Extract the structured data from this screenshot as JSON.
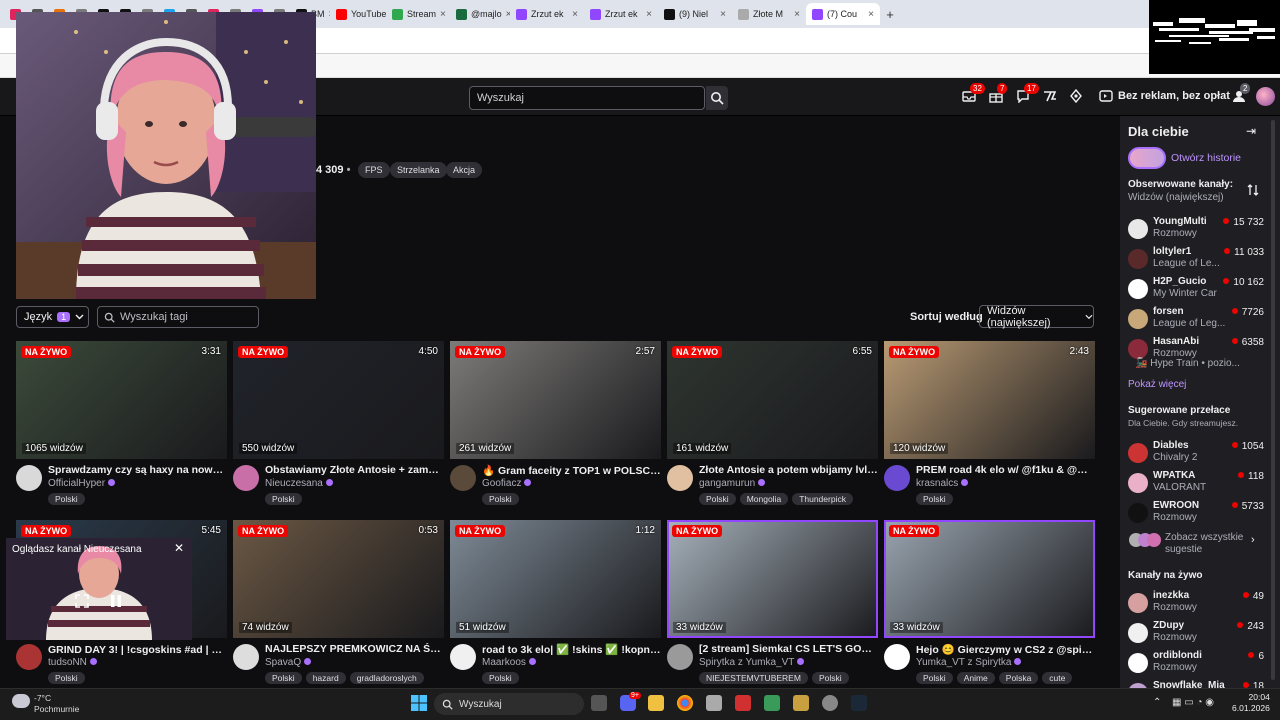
{
  "browser": {
    "tabs": [
      {
        "label": "",
        "color": "#e0245e"
      },
      {
        "label": "",
        "color": "#555"
      },
      {
        "label": "",
        "color": "#e8710a"
      },
      {
        "label": "",
        "color": "#7a7a7a"
      },
      {
        "label": "",
        "color": "#111"
      },
      {
        "label": "",
        "color": "#111"
      },
      {
        "label": "",
        "color": "#7a7a7a"
      },
      {
        "label": "",
        "color": "#1da1f2"
      },
      {
        "label": "",
        "color": "#555"
      },
      {
        "label": "",
        "color": "#e0245e"
      },
      {
        "label": "",
        "color": "#7a7a7a"
      },
      {
        "label": "",
        "color": "#9147ff"
      },
      {
        "label": "",
        "color": "#7a7a7a"
      },
      {
        "label": "BM",
        "color": "#111"
      },
      {
        "label": "YouTube",
        "color": "#ff0000"
      },
      {
        "label": "Stream",
        "color": "#2fa84f"
      },
      {
        "label": "@majlo",
        "color": "#1a6b3d"
      },
      {
        "label": "Zrzut ek",
        "color": "#9147ff"
      },
      {
        "label": "Zrzut ek",
        "color": "#9147ff"
      },
      {
        "label": "(9) Niel",
        "color": "#111"
      },
      {
        "label": "Złote M",
        "color": "#aaa"
      },
      {
        "label": "(7) Cou",
        "color": "#9147ff",
        "active": true
      }
    ]
  },
  "topnav": {
    "search_placeholder": "Wyszukaj",
    "inbox_count": "32",
    "drops_count": "7",
    "notifications_count": "17",
    "ad_free_label": "Bez reklam, bez opłat",
    "bits_count": "2"
  },
  "category": {
    "viewers": "4 309",
    "tags": [
      "FPS",
      "Strzelanka",
      "Akcja"
    ]
  },
  "filters": {
    "language_label": "Język",
    "language_count": "1",
    "tag_search_placeholder": "Wyszukaj tagi",
    "sort_label": "Sortuj według",
    "sort_value": "Widzów (największej)"
  },
  "live_label": "NA ŻYWO",
  "streams": [
    {
      "duration": "3:31",
      "viewers": "1065 widzów",
      "title": "Sprawdzamy czy są haxy na nowym V...",
      "channel": "OfficialHyper",
      "tags": [
        "Polski"
      ],
      "thumb": "#3b4a3a",
      "avatar": "#d9d9d9"
    },
    {
      "duration": "4:50",
      "viewers": "550 widzów",
      "title": "Obstawiamy Złote Antosie + zamówił...",
      "channel": "Nieuczesana",
      "tags": [
        "Polski"
      ],
      "thumb": "#20232a",
      "avatar": "#c86fa8"
    },
    {
      "duration": "2:57",
      "viewers": "261 widzów",
      "title": "🔥 Gram faceity z TOP1 w POLSCE, a ...",
      "channel": "Goofiacz",
      "tags": [
        "Polski"
      ],
      "thumb": "#7d7b78",
      "avatar": "#5a4a3a"
    },
    {
      "duration": "6:55",
      "viewers": "161 widzów",
      "title": "Złote Antosie a potem wbijamy lvl8 si...",
      "channel": "gangamurun",
      "tags": [
        "Polski",
        "Mongolia",
        "Thunderpick"
      ],
      "thumb": "#2e3530",
      "avatar": "#e0c0a0"
    },
    {
      "duration": "2:43",
      "viewers": "120 widzów",
      "title": "PREM road 4k elo w/ @f1ku & @mchk_",
      "channel": "krasnalcs",
      "tags": [
        "Polski"
      ],
      "thumb": "#b99a73",
      "avatar": "#6a4ad0"
    },
    {
      "duration": "5:45",
      "viewers": "",
      "title": "GRIND DAY 3! | !csgoskins #ad | 🎁 !p...",
      "channel": "tudsoNN",
      "tags": [
        "Polski"
      ],
      "thumb": "#2a3a4a",
      "avatar": "#aa3333"
    },
    {
      "duration": "0:53",
      "viewers": "74 widzów",
      "title": "NAJLEPSZY PREMKOWICZ NA ŚWIEC...",
      "channel": "SpavaQ",
      "tags": [
        "Polski",
        "hazard",
        "gradladoroslych"
      ],
      "thumb": "#6b5844",
      "avatar": "#dddddd"
    },
    {
      "duration": "1:12",
      "viewers": "51 widzów",
      "title": "road to 3k elo| ✅ !skins ✅ !kopniak ...",
      "channel": "Maarkoos",
      "tags": [
        "Polski"
      ],
      "thumb": "#7e8a96",
      "avatar": "#f0f0f0"
    },
    {
      "duration": "",
      "viewers": "33 widzów",
      "title": "[2 stream] Siemka! CS LET'S GOO! z/...",
      "channel": "Spirytka z Yumka_VT",
      "tags": [
        "NIEJESTEMVTUBEREM",
        "Polski"
      ],
      "thumb": "#a7b2bc",
      "avatar": "#9a9a9a"
    },
    {
      "duration": "",
      "viewers": "33 widzów",
      "title": "Hejo 😊 Gierczymy w CS2 z @spirytk...",
      "channel": "Yumka_VT z Spirytka",
      "tags": [
        "Polski",
        "Anime",
        "Polska",
        "cute"
      ],
      "thumb": "#9aa5b0",
      "avatar": "#ffffff"
    }
  ],
  "miniplayer": {
    "label": "Oglądasz kanał Nieuczesana"
  },
  "sidebar": {
    "title": "Dla ciebie",
    "story_label": "Otwórz historie",
    "followed_label": "Obserwowane kanały:",
    "followed_sort": "Widzów (największej)",
    "followed": [
      {
        "name": "YoungMulti",
        "category": "Rozmowy",
        "viewers": "15 732",
        "avatar": "#e8e8e8"
      },
      {
        "name": "loltyler1",
        "category": "League of Le...",
        "viewers": "11 033",
        "avatar": "#5a2a2a"
      },
      {
        "name": "H2P_Gucio",
        "category": "My Winter Car",
        "viewers": "10 162",
        "avatar": "#ffffff"
      },
      {
        "name": "forsen",
        "category": "League of Leg...",
        "viewers": "7726",
        "avatar": "#c8a878"
      },
      {
        "name": "HasanAbi",
        "category": "Rozmowy",
        "viewers": "6358",
        "avatar": "#8a2a3a"
      }
    ],
    "hype_train": "🚂 Hype Train • pozio...",
    "show_more": "Pokaż więcej",
    "suggested_label": "Sugerowane przełace",
    "suggested_sub": "Dla Ciebie. Gdy streamujesz.",
    "suggested": [
      {
        "name": "Diables",
        "category": "Chivalry 2",
        "viewers": "1054",
        "avatar": "#cc3333"
      },
      {
        "name": "WPATKA",
        "category": "VALORANT",
        "viewers": "118",
        "avatar": "#e9b0c8"
      },
      {
        "name": "EWROON",
        "category": "Rozmowy",
        "viewers": "5733",
        "avatar": "#111111"
      }
    ],
    "see_all": "Zobacz wszystkie sugestie",
    "live_label": "Kanały na żywo",
    "live_channels": [
      {
        "name": "inezkka",
        "category": "Rozmowy",
        "viewers": "49",
        "avatar": "#d6a0a0"
      },
      {
        "name": "ZDupy",
        "category": "Rozmowy",
        "viewers": "243",
        "avatar": "#f0f0f0"
      },
      {
        "name": "ordiblondi",
        "category": "Rozmowy",
        "viewers": "6",
        "avatar": "#ffffff"
      },
      {
        "name": "Snowflake_Mia",
        "category": "",
        "viewers": "18",
        "avatar": "#c0a0d0"
      }
    ]
  },
  "taskbar": {
    "temperature": "-7°C",
    "weather": "Pochmurnie",
    "search_placeholder": "Wyszukaj",
    "time": "20:04",
    "date": "6.01.2026",
    "discord_badge": "9+"
  }
}
